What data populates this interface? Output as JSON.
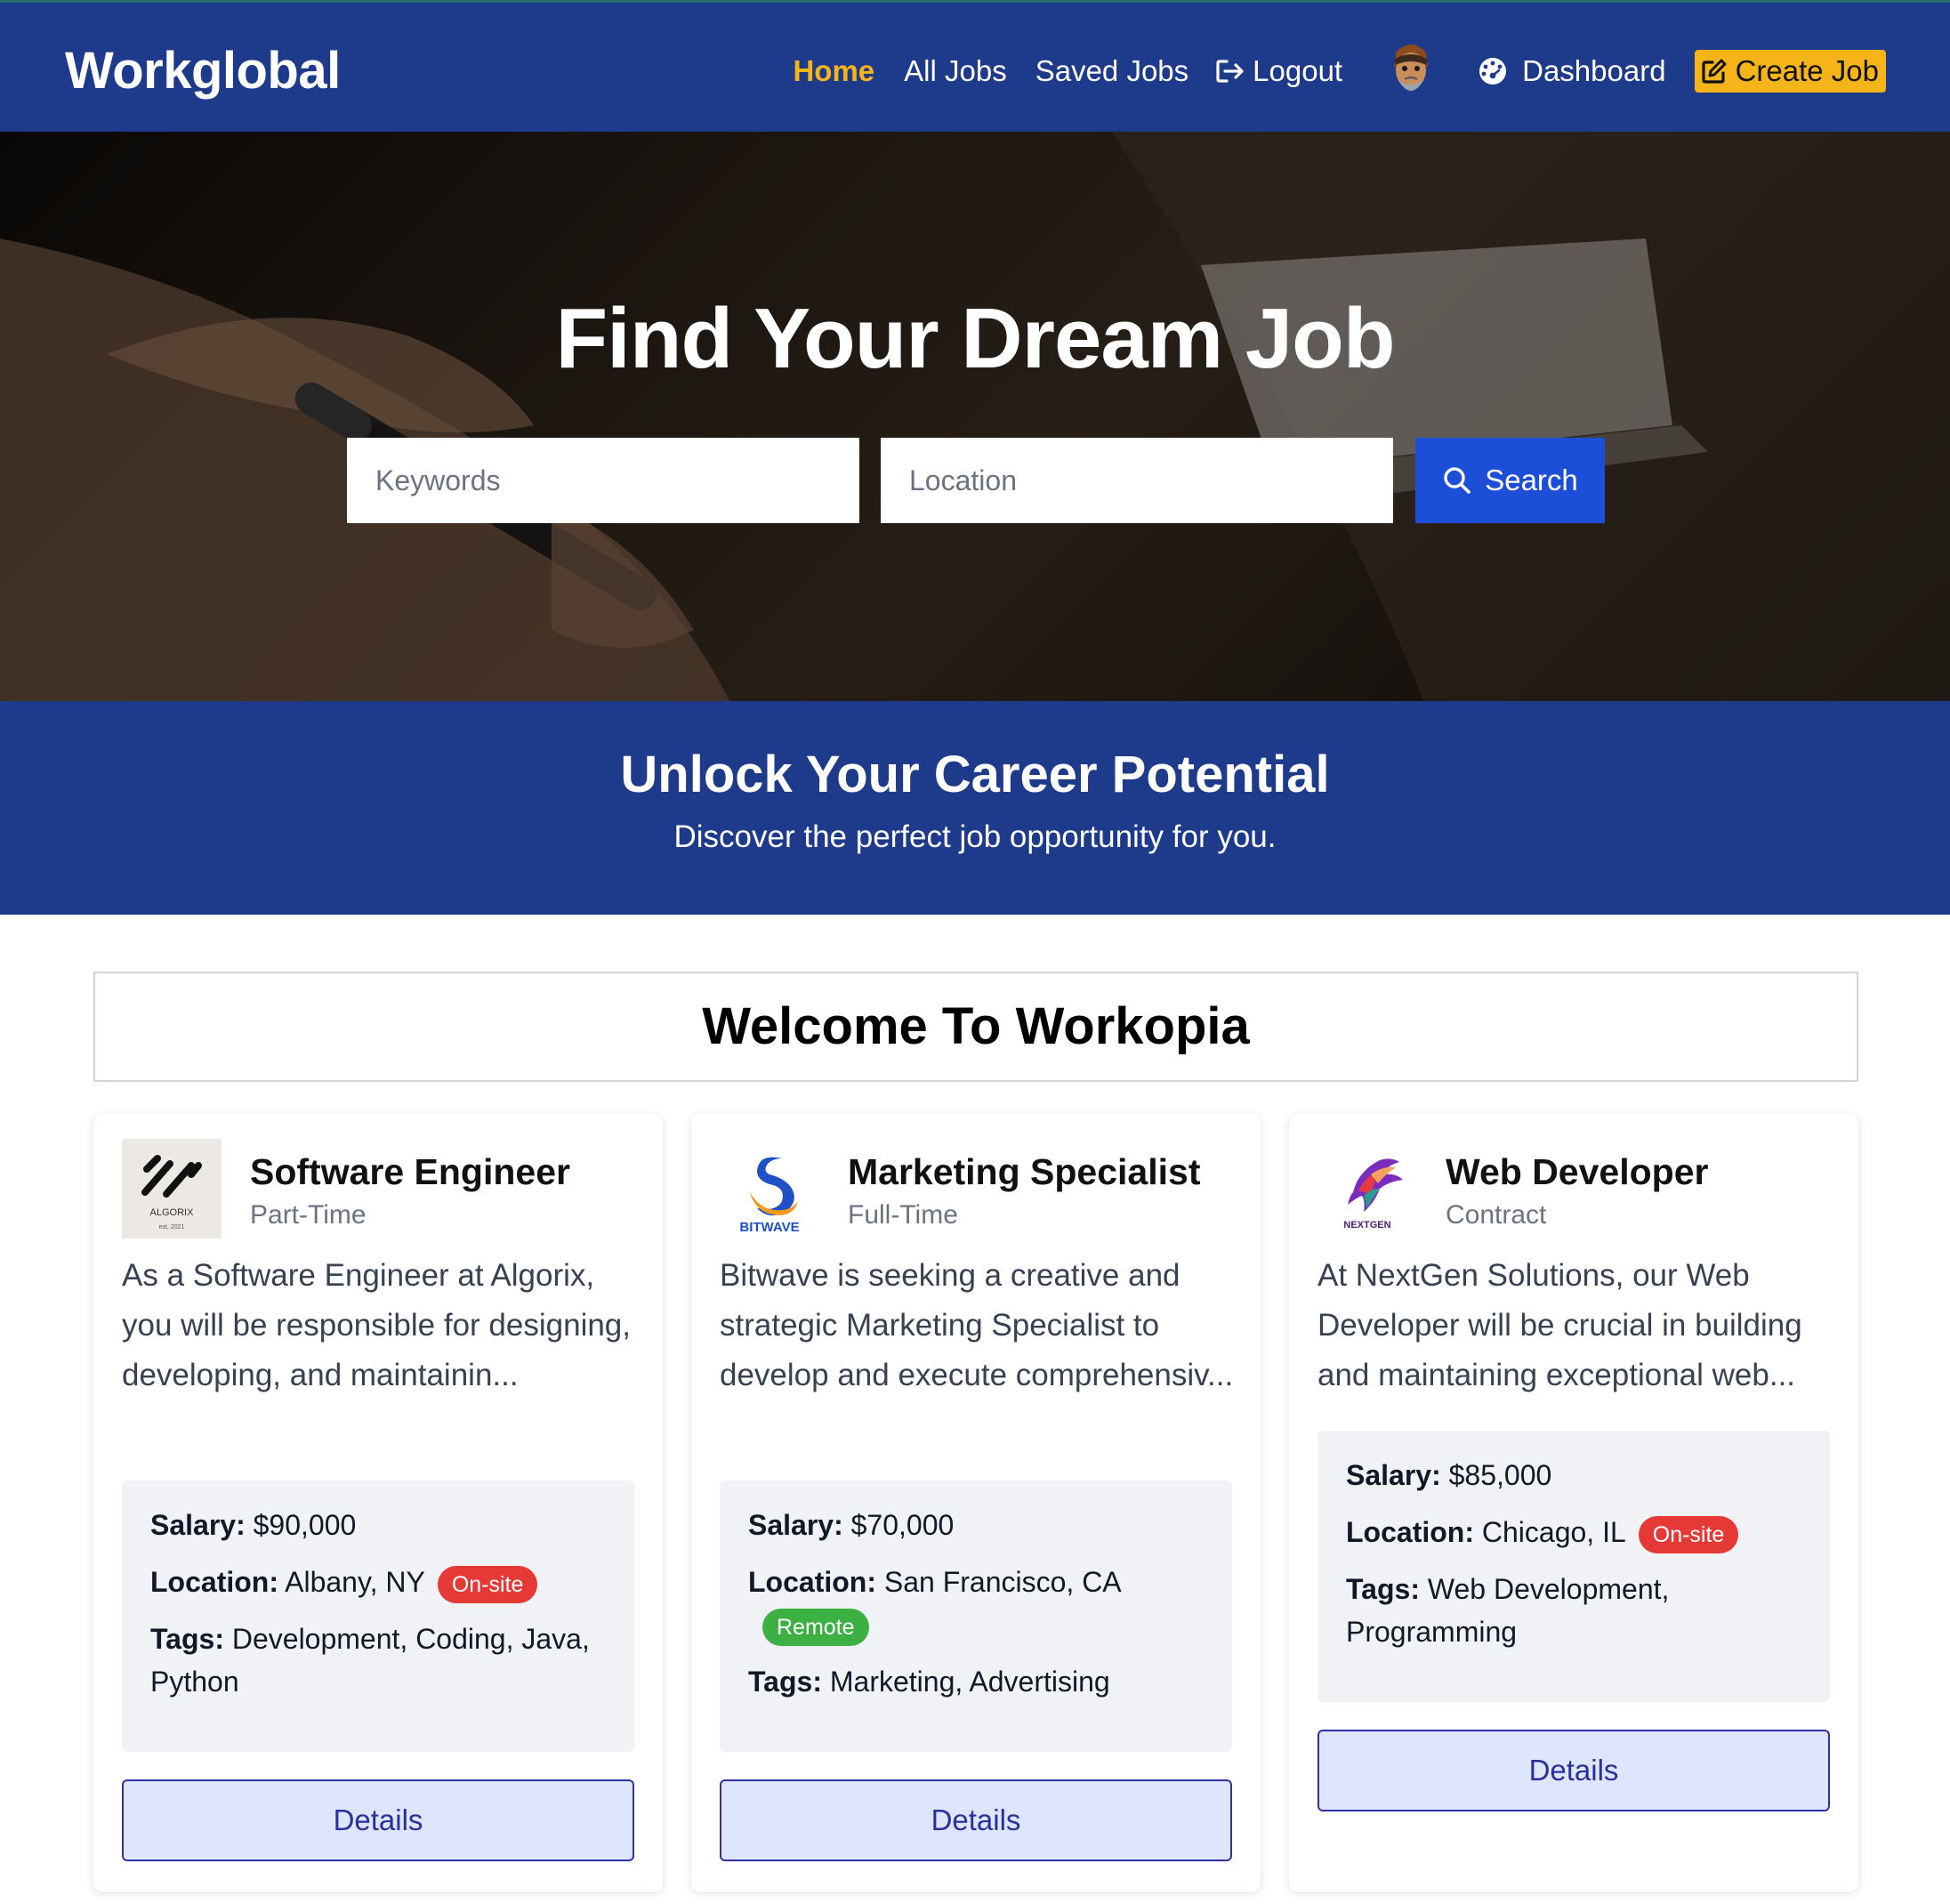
{
  "navbar": {
    "brand": "Workglobal",
    "links": {
      "home": "Home",
      "all_jobs": "All Jobs",
      "saved_jobs": "Saved Jobs",
      "logout": "Logout",
      "dashboard": "Dashboard",
      "create_job": "Create Job"
    },
    "active_link": "home",
    "colors": {
      "background": "#1e3a8a",
      "active": "#f5b519",
      "create_button": "#f5b519"
    }
  },
  "hero": {
    "title": "Find Your Dream Job",
    "search": {
      "keywords_placeholder": "Keywords",
      "location_placeholder": "Location",
      "button_label": "Search",
      "button_color": "#1d4ed8"
    }
  },
  "banner": {
    "title": "Unlock Your Career Potential",
    "subtitle": "Discover the perfect job opportunity for you."
  },
  "welcome": {
    "title": "Welcome To Workopia"
  },
  "jobs": [
    {
      "title": "Software Engineer",
      "type": "Part-Time",
      "company_logo": "algorix-logo",
      "logo_text": "ALGORIX",
      "logo_subtext": "est. 2021",
      "description": "As a Software Engineer at Algorix, you will be responsible for designing, developing, and maintainin...",
      "salary_label": "Salary:",
      "salary": "$90,000",
      "location_label": "Location:",
      "location": "Albany, NY",
      "work_mode": "On-site",
      "tags_label": "Tags:",
      "tags": "Development, Coding, Java, Python",
      "details_label": "Details"
    },
    {
      "title": "Marketing Specialist",
      "type": "Full-Time",
      "company_logo": "bitwave-logo",
      "logo_text": "BITWAVE",
      "description": "Bitwave is seeking a creative and strategic Marketing Specialist to develop and execute comprehensiv...",
      "salary_label": "Salary:",
      "salary": "$70,000",
      "location_label": "Location:",
      "location": "San Francisco, CA",
      "work_mode": "Remote",
      "tags_label": "Tags:",
      "tags": "Marketing, Advertising",
      "details_label": "Details"
    },
    {
      "title": "Web Developer",
      "type": "Contract",
      "company_logo": "nextgen-logo",
      "logo_text": "NEXTGEN",
      "description": "At NextGen Solutions, our Web Developer will be crucial in building and maintaining exceptional web...",
      "salary_label": "Salary:",
      "salary": "$85,000",
      "location_label": "Location:",
      "location": "Chicago, IL",
      "work_mode": "On-site",
      "tags_label": "Tags:",
      "tags": "Web Development, Programming",
      "details_label": "Details"
    }
  ],
  "colors": {
    "onsite_badge": "#e53935",
    "remote_badge": "#3cb043",
    "details_button_bg": "#dee6ff",
    "details_button_border": "#3230a6"
  }
}
